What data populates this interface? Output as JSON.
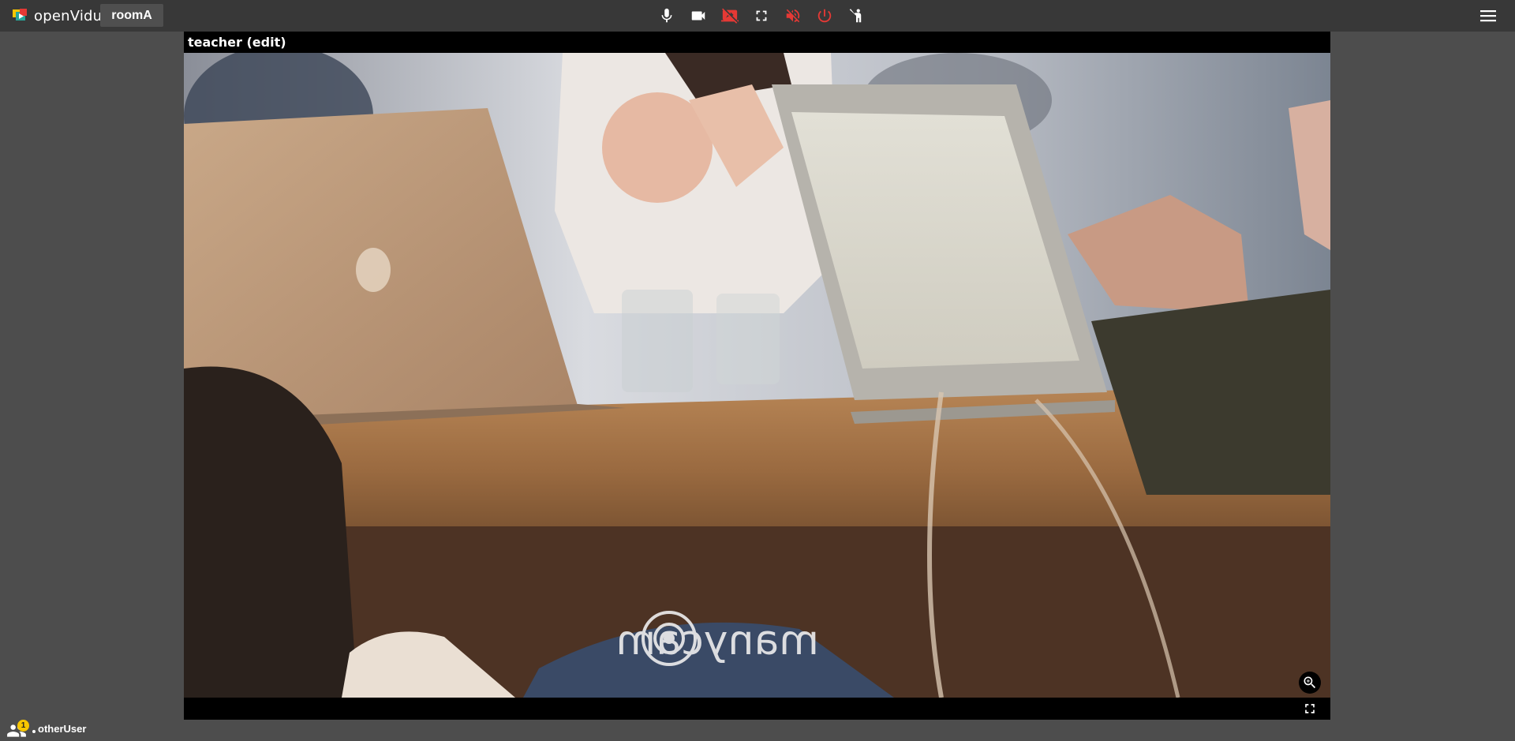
{
  "header": {
    "brand": "openVidu",
    "room_name": "roomA",
    "toolbar": [
      {
        "name": "microphone",
        "icon": "mic-icon",
        "state": "on"
      },
      {
        "name": "camera",
        "icon": "videocam-icon",
        "state": "on"
      },
      {
        "name": "screen-share",
        "icon": "screen-share-off-icon",
        "state": "off"
      },
      {
        "name": "fullscreen",
        "icon": "fullscreen-icon",
        "state": "normal"
      },
      {
        "name": "speaker",
        "icon": "volume-off-icon",
        "state": "off"
      },
      {
        "name": "leave-session",
        "icon": "power-icon",
        "state": "danger"
      },
      {
        "name": "raise-hand",
        "icon": "hand-icon",
        "state": "normal"
      }
    ],
    "menu_icon": "menu-icon"
  },
  "stream": {
    "name": "teacher (edit)",
    "watermark": "manycam",
    "zoom_icon": "zoom-in-icon",
    "fullscreen_icon": "fullscreen-icon"
  },
  "participants": {
    "badge_count": "1",
    "user_name": "otherUser"
  },
  "colors": {
    "background": "#4d4d4d",
    "topbar": "#383838",
    "danger": "#e53935",
    "badge": "#f7c600",
    "stream_frame": "#000000"
  }
}
